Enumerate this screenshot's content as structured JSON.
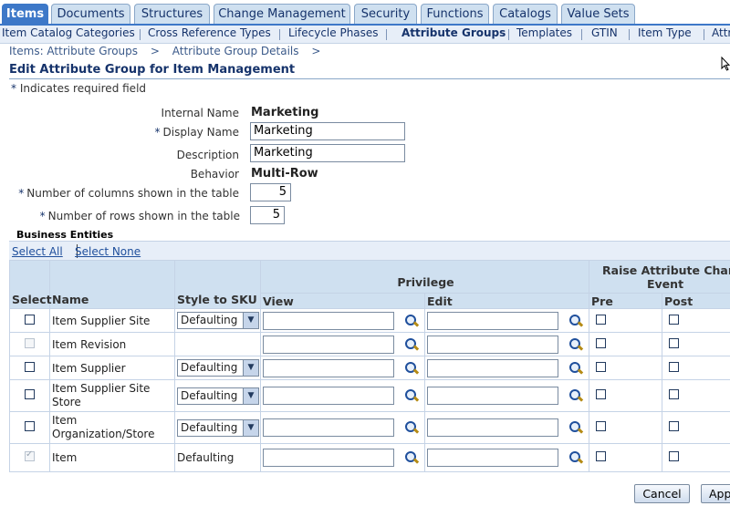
{
  "tabs": [
    "Items",
    "Documents",
    "Structures",
    "Change Management",
    "Security",
    "Functions",
    "Catalogs",
    "Value Sets"
  ],
  "subtabs": [
    "Item Catalog Categories",
    "Cross Reference Types",
    "Lifecycle Phases",
    "Attribute Groups",
    "Templates",
    "GTIN",
    "Item Type",
    "Attr"
  ],
  "breadcrumb": [
    "Items: Attribute Groups",
    ">",
    "Attribute Group Details",
    ">"
  ],
  "page_title": "Edit Attribute Group for Item Management",
  "required_note": "Indicates required field",
  "required_star": "*",
  "form": {
    "internal_name_label": "Internal Name",
    "internal_name_value": "Marketing",
    "display_name_label": "Display Name",
    "display_name_value": "Marketing",
    "description_label": "Description",
    "description_value": "Marketing",
    "behavior_label": "Behavior",
    "behavior_value": "Multi-Row",
    "columns_label": "Number of columns shown in the table",
    "columns_value": "5",
    "rows_label": "Number of rows shown in the table",
    "rows_value": "5"
  },
  "business_entities": {
    "heading": "Business Entities",
    "select_all": "Select All",
    "select_none": "Select None",
    "headers": {
      "select": "Select",
      "name": "Name",
      "style": "Style to SKU",
      "privilege": "Privilege",
      "view": "View",
      "edit": "Edit",
      "raise_line1": "Raise Attribute Chang",
      "raise_line2": "Event",
      "pre": "Pre",
      "post": "Post"
    },
    "rows": [
      {
        "name": "Item Supplier Site",
        "style": "Defaulting"
      },
      {
        "name": "Item Revision",
        "style": ""
      },
      {
        "name": "Item Supplier",
        "style": "Defaulting"
      },
      {
        "name": "Item Supplier Site Store",
        "style": "Defaulting"
      },
      {
        "name": "Item Organization/Store",
        "style": "Defaulting"
      },
      {
        "name": "Item",
        "style": "Defaulting"
      }
    ]
  },
  "buttons": {
    "cancel": "Cancel",
    "apply": "App"
  }
}
